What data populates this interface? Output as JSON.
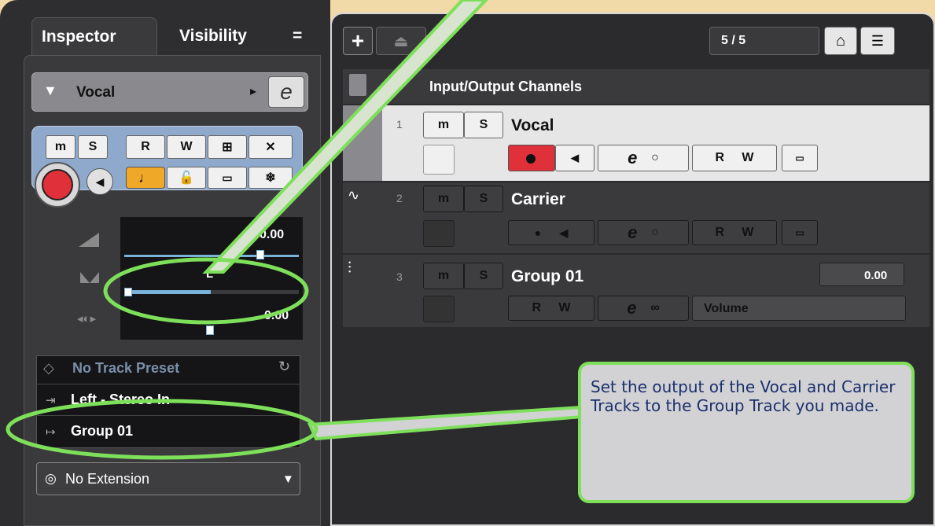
{
  "inspector": {
    "tab_inspector": "Inspector",
    "tab_visibility": "Visibility",
    "tab_menu": "=",
    "track_name": "Vocal",
    "m": "m",
    "s": "S",
    "r": "R",
    "w": "W",
    "volume_value": "0.00",
    "pan_label": "L",
    "delay_value": "0.00",
    "preset_label": "No Track Preset",
    "input_routing": "Left - Stereo In",
    "output_routing": "Group 01",
    "extension_label": "No Extension"
  },
  "project": {
    "counter": "5 / 5",
    "folder_title": "Input/Output Channels",
    "tracks": [
      {
        "number": "1",
        "name": "Vocal"
      },
      {
        "number": "2",
        "name": "Carrier"
      },
      {
        "number": "3",
        "name": "Group 01",
        "volume": "0.00",
        "automation": "Volume"
      }
    ]
  },
  "callout": {
    "text": "Set the output of the Vocal and Carrier Tracks to the Group Track you made."
  },
  "colors": {
    "highlight": "#7ee05a",
    "record": "#e0303a",
    "accent": "#f0a828",
    "callout_text": "#1a2f6d"
  }
}
